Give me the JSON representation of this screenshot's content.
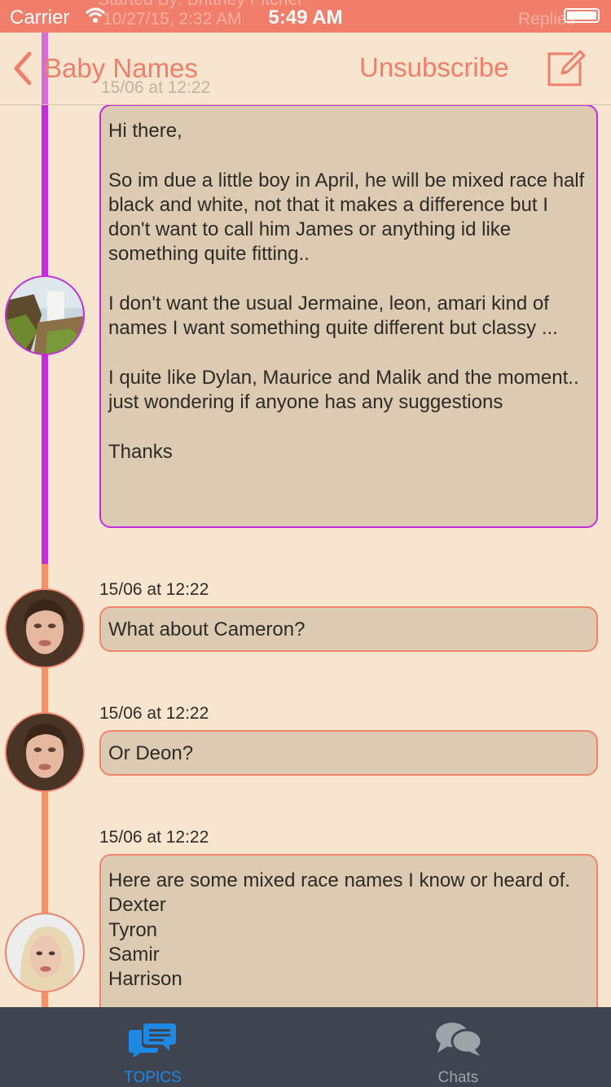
{
  "status_bar": {
    "carrier": "Carrier",
    "time": "5:49 AM",
    "ghost_header": "Started By:  Brittney Pitcher",
    "ghost_date": "10/27/15, 2:32 AM",
    "ghost_replies": "Replies"
  },
  "nav": {
    "back_label": "Baby Names",
    "unsubscribe_label": "Unsubscribe",
    "ghost_date": "15/06 at 12:22"
  },
  "posts": [
    {
      "timestamp": "",
      "body": "Hi there,\n\nSo im due a little boy in April, he will be mixed race half black and white, not that it makes a difference but I don't want to call him James or anything id like something quite fitting..\n\nI don't want the usual Jermaine, leon, amari kind of names I want something quite different but classy ...\n\nI quite like Dylan, Maurice and Malik and the moment.. just wondering if anyone has any suggestions\n\nThanks"
    },
    {
      "timestamp": "15/06 at 12:22",
      "body": "What about Cameron?"
    },
    {
      "timestamp": "15/06 at 12:22",
      "body": "Or Deon?"
    },
    {
      "timestamp": "15/06 at 12:22",
      "body": "Here are some mixed race names I know or heard of.\nDexter\nTyron\nSamir\nHarrison"
    }
  ],
  "tabs": [
    {
      "label": "TOPICS",
      "icon": "chat-bubbles-icon"
    },
    {
      "label": "Chats",
      "icon": "chat-bubbles-icon"
    }
  ],
  "colors": {
    "accent": "#F07E6A",
    "timeline_original_poster": "#C42BDD",
    "timeline_reply": "#F79067",
    "bubble": "#DCCBB2",
    "background": "#F8E5CF",
    "tab_active": "#1E88E5"
  }
}
